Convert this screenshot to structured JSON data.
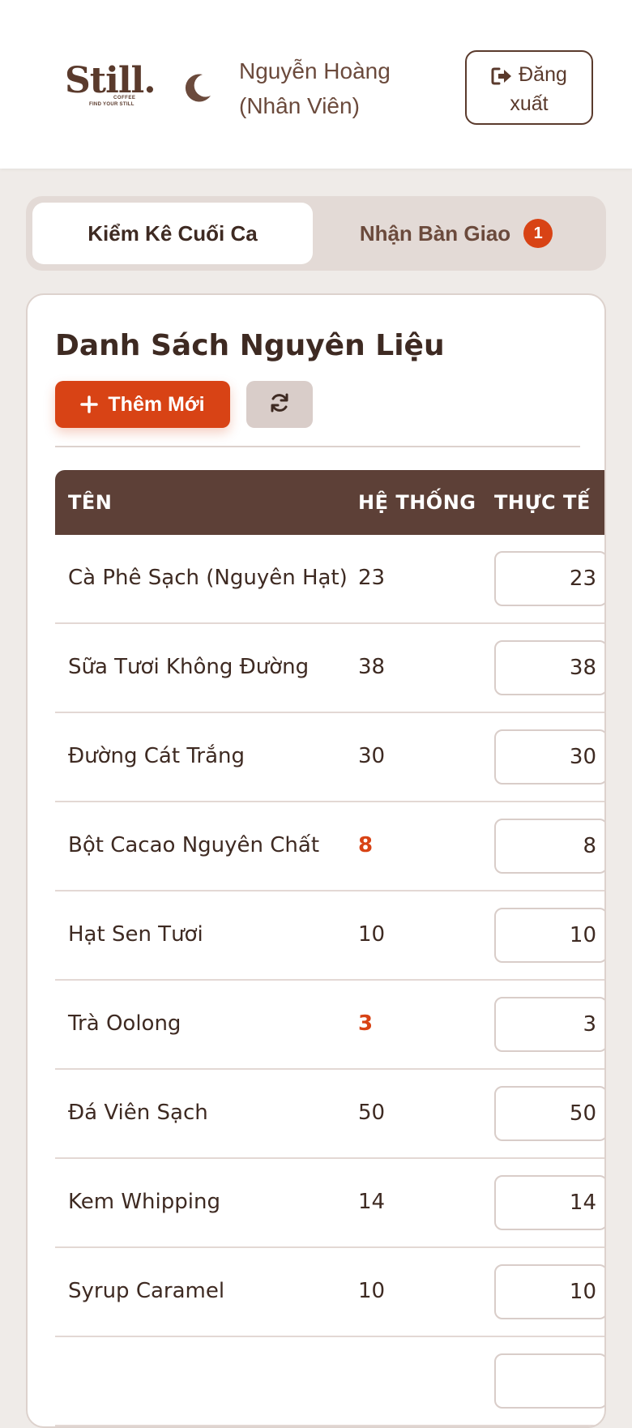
{
  "header": {
    "logo": {
      "word": "Still.",
      "sub1": "COFFEE",
      "sub2": "FIND YOUR STILL"
    },
    "user_line1": "Nguyễn Hoàng",
    "user_line2": "(Nhân Viên)",
    "logout_line1": "Đăng",
    "logout_line2": "xuất"
  },
  "tabs": {
    "active": "Kiểm Kê Cuối Ca",
    "inactive": "Nhận Bàn Giao",
    "badge": "1"
  },
  "card": {
    "title": "Danh Sách Nguyên Liệu",
    "add_label": "Thêm Mới"
  },
  "table": {
    "headers": {
      "name": "TÊN",
      "system": "HỆ THỐNG",
      "actual": "THỰC TẾ"
    },
    "rows": [
      {
        "name": "Cà Phê Sạch (Nguyên Hạt)",
        "system": "23",
        "actual": "23",
        "low": false
      },
      {
        "name": "Sữa Tươi Không Đường",
        "system": "38",
        "actual": "38",
        "low": false
      },
      {
        "name": "Đường Cát Trắng",
        "system": "30",
        "actual": "30",
        "low": false
      },
      {
        "name": "Bột Cacao Nguyên Chất",
        "system": "8",
        "actual": "8",
        "low": true
      },
      {
        "name": "Hạt Sen Tươi",
        "system": "10",
        "actual": "10",
        "low": false
      },
      {
        "name": "Trà Oolong",
        "system": "3",
        "actual": "3",
        "low": true
      },
      {
        "name": "Đá Viên Sạch",
        "system": "50",
        "actual": "50",
        "low": false
      },
      {
        "name": "Kem Whipping",
        "system": "14",
        "actual": "14",
        "low": false
      },
      {
        "name": "Syrup Caramel",
        "system": "10",
        "actual": "10",
        "low": false
      },
      {
        "name": "",
        "system": "",
        "actual": "",
        "low": false
      }
    ]
  },
  "colors": {
    "accent": "#d84315",
    "brown": "#5d4037",
    "background": "#efebe8"
  }
}
